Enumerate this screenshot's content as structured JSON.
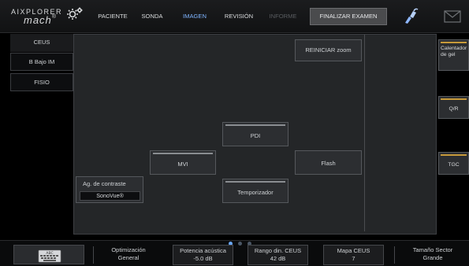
{
  "logo": {
    "line1": "AIXPLORER",
    "line2": "mach",
    "suffix": "®"
  },
  "nav": {
    "tabs": [
      "PACIENTE",
      "SONDA",
      "IMAGEN",
      "REVISIÓN",
      "INFORME"
    ],
    "active_tab": "IMAGEN",
    "disabled_tab": "INFORME",
    "finish_button": "FINALIZAR EXAMEN"
  },
  "left_tabs": [
    "CEUS",
    "B Bajo IM",
    "FISIO"
  ],
  "panel": {
    "reset_zoom": "REINICIAR zoom",
    "pdi": "PDI",
    "mvi": "MVI",
    "flash": "Flash",
    "timer": "Temporizador",
    "contrast_label": "Ag. de contraste",
    "contrast_value": "SonoVue®"
  },
  "right_buttons": {
    "gel_warmer": "Calentador de gel",
    "qr": "Q/R",
    "tgc": "TGC"
  },
  "bottom": {
    "keyboard_label": "ABC",
    "fields": [
      {
        "label": "Optimización",
        "value": "General"
      },
      {
        "label": "Potencia acústica",
        "value": "-5.0 dB"
      },
      {
        "label": "Rango din. CEUS",
        "value": "42 dB"
      },
      {
        "label": "Mapa CEUS",
        "value": "7"
      },
      {
        "label": "Tamaño Sector",
        "value": "Grande"
      }
    ],
    "page_count": 3,
    "current_page": 1
  },
  "colors": {
    "active_tab": "#7fb4ff",
    "disabled_tab": "#5a5d61",
    "panel_bg": "#242628",
    "accent_bar": "#c79a3a"
  }
}
